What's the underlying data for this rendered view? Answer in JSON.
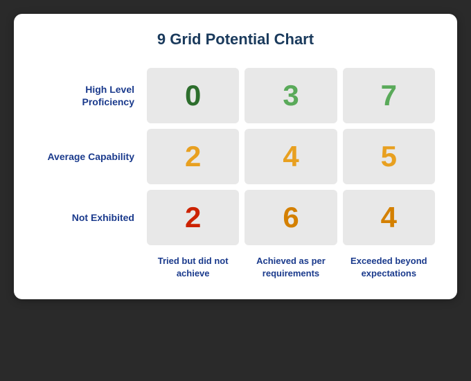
{
  "chart": {
    "title": "9 Grid Potential Chart",
    "row_labels": [
      "High Level Proficiency",
      "Average Capability",
      "Not Exhibited"
    ],
    "col_labels": [
      "Tried but did not achieve",
      "Achieved as per requirements",
      "Exceeded beyond expectations"
    ],
    "cells": [
      [
        {
          "value": "0",
          "color": "color-dark-green"
        },
        {
          "value": "3",
          "color": "color-light-green"
        },
        {
          "value": "7",
          "color": "color-light-green"
        }
      ],
      [
        {
          "value": "2",
          "color": "color-orange"
        },
        {
          "value": "4",
          "color": "color-orange"
        },
        {
          "value": "5",
          "color": "color-orange"
        }
      ],
      [
        {
          "value": "2",
          "color": "color-red"
        },
        {
          "value": "6",
          "color": "color-dark-orange"
        },
        {
          "value": "4",
          "color": "color-dark-orange"
        }
      ]
    ]
  }
}
